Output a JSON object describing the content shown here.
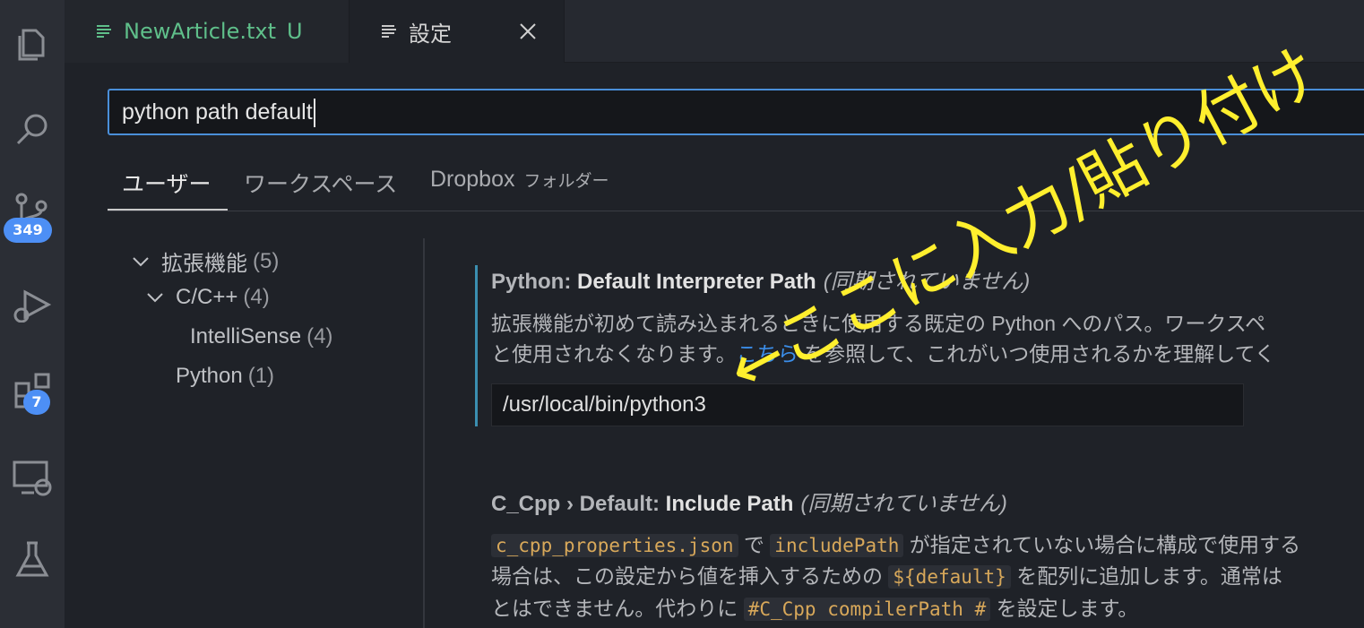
{
  "activity_bar": {
    "scm_badge": "349",
    "extensions_badge": "7",
    "icons": [
      "explorer-icon",
      "search-icon",
      "source-control-icon",
      "run-debug-icon",
      "extensions-icon",
      "remote-explorer-icon",
      "testing-icon"
    ]
  },
  "tabs": [
    {
      "name": "NewArticle.txt",
      "status": "U"
    },
    {
      "name": "設定"
    }
  ],
  "search": {
    "value": "python path default"
  },
  "scope_tabs": {
    "user": "ユーザー",
    "workspace": "ワークスペース",
    "folder": "Dropbox",
    "folder_sub": "フォルダー"
  },
  "tree": [
    {
      "label": "拡張機能",
      "count": "(5)"
    },
    {
      "label": "C/C++",
      "count": "(4)"
    },
    {
      "label": "IntelliSense",
      "count": "(4)"
    },
    {
      "label": "Python",
      "count": "(1)"
    }
  ],
  "setting1": {
    "category": "Python: ",
    "key": "Default Interpreter Path",
    "sync": "(同期されていません)",
    "desc_line1": "拡張機能が初めて読み込まれるときに使用する既定の Python へのパス。ワークスペ",
    "desc_line2_pre": "と使用されなくなります。",
    "desc_link": "こちら",
    "desc_line2_post": " を参照して、これがいつ使用されるかを理解してく",
    "value": "/usr/local/bin/python3"
  },
  "setting2": {
    "category": "C_Cpp › Default: ",
    "key": "Include Path",
    "sync": "(同期されていません)",
    "code1": "c_cpp_properties.json",
    "t1": " で ",
    "code2": "includePath",
    "t2": " が指定されていない場合に構成で使用する",
    "t3": "場合は、この設定から値を挿入するための ",
    "code3": "${default}",
    "t4": " を配列に追加します。通常は",
    "t5": "とはできません。代わりに ",
    "code4": "#C_Cpp compilerPath #",
    "t6": " を設定します。"
  },
  "annotation": {
    "text": "←ここに入力/貼り付け",
    "color": "#ffef2e"
  }
}
